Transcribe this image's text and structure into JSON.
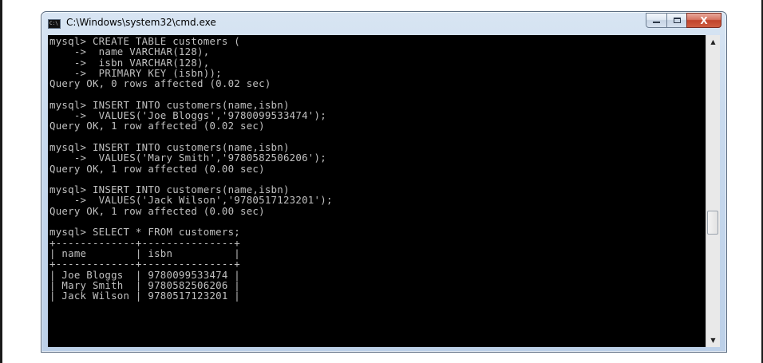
{
  "window": {
    "title": "C:\\Windows\\system32\\cmd.exe",
    "icon_label": "C:\\",
    "buttons": {
      "minimize": "minimize-icon",
      "maximize": "maximize-icon",
      "close": "close-icon",
      "close_glyph": "X"
    }
  },
  "console": {
    "lines": [
      "mysql> CREATE TABLE customers (",
      "    ->  name VARCHAR(128),",
      "    ->  isbn VARCHAR(128),",
      "    ->  PRIMARY KEY (isbn));",
      "Query OK, 0 rows affected (0.02 sec)",
      "",
      "mysql> INSERT INTO customers(name,isbn)",
      "    ->  VALUES('Joe Bloggs','9780099533474');",
      "Query OK, 1 row affected (0.02 sec)",
      "",
      "mysql> INSERT INTO customers(name,isbn)",
      "    ->  VALUES('Mary Smith','9780582506206');",
      "Query OK, 1 row affected (0.00 sec)",
      "",
      "mysql> INSERT INTO customers(name,isbn)",
      "    ->  VALUES('Jack Wilson','9780517123201');",
      "Query OK, 1 row affected (0.00 sec)",
      "",
      "mysql> SELECT * FROM customers;",
      "+-------------+---------------+",
      "| name        | isbn          |",
      "+-------------+---------------+",
      "| Joe Bloggs  | 9780099533474 |",
      "| Mary Smith  | 9780582506206 |",
      "| Jack Wilson | 9780517123201 |"
    ]
  },
  "scrollbar": {
    "up_arrow": "▲",
    "down_arrow": "▼",
    "position": 0.62
  }
}
